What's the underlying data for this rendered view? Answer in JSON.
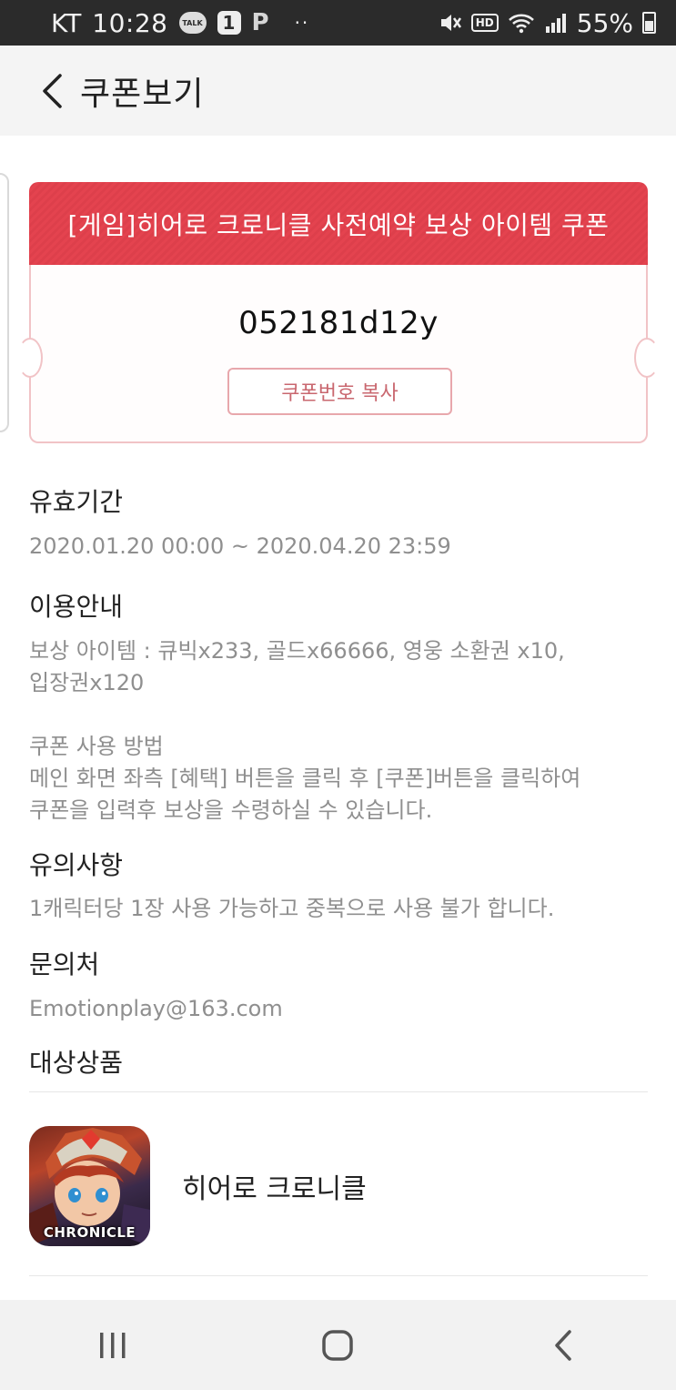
{
  "status_bar": {
    "carrier": "KT",
    "time": "10:28",
    "notif_talk": "TALK",
    "notif_badge": "1",
    "notif_p": "P",
    "more": "··",
    "hd": "HD",
    "battery": "55%"
  },
  "header": {
    "title": "쿠폰보기"
  },
  "coupon": {
    "title": "[게임]히어로 크로니클 사전예약 보상 아이템 쿠폰",
    "code": "052181d12y",
    "copy_label": "쿠폰번호 복사",
    "accent_color": "#e4434f"
  },
  "validity": {
    "title": "유효기간",
    "text": "2020.01.20 00:00 ~ 2020.04.20 23:59"
  },
  "usage": {
    "title": "이용안내",
    "line1": "보상 아이템 : 큐빅x233, 골드x66666, 영웅 소환권 x10,",
    "line2": "입장권x120",
    "line3": "쿠폰 사용 방법",
    "line4": "메인 화면 좌측 [혜택] 버튼을 클릭 후 [쿠폰]버튼을 클릭하여",
    "line5": "쿠폰을 입력후 보상을 수령하실 수 있습니다."
  },
  "caution": {
    "title": "유의사항",
    "text": "1캐릭터당 1장 사용 가능하고 중복으로 사용 불가 합니다."
  },
  "contact": {
    "title": "문의처",
    "text": "Emotionplay@163.com"
  },
  "products": {
    "title": "대상상품",
    "item_name": "히어로 크로니클",
    "icon_caption": "CHRONICLE"
  }
}
